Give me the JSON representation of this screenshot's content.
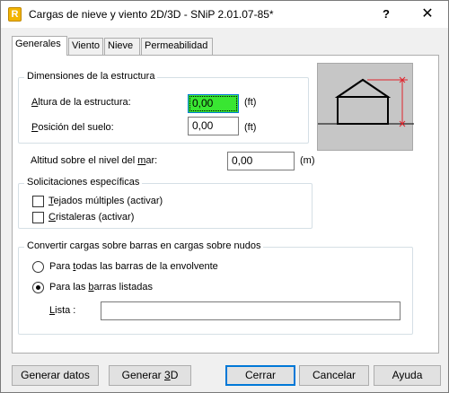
{
  "window": {
    "title": "Cargas de nieve y viento 2D/3D - SNiP 2.01.07-85*",
    "app_icon_letter": "R",
    "help_glyph": "?",
    "close_glyph": "✕"
  },
  "tabs": [
    {
      "label": "Generales",
      "active": true
    },
    {
      "label": "Viento",
      "active": false
    },
    {
      "label": "Nieve",
      "active": false
    },
    {
      "label": "Permeabilidad",
      "active": false
    }
  ],
  "dimensiones": {
    "title": "Dimensiones de la estructura",
    "altura": {
      "label_u": "A",
      "label_rest": "ltura de la estructura:",
      "value": "0,00",
      "unit": "(ft)"
    },
    "posicion": {
      "label_u": "P",
      "label_rest": "osición del suelo:",
      "value": "0,00",
      "unit": "(ft)"
    }
  },
  "altitud": {
    "label_pre": "Altitud sobre el nivel del ",
    "label_u": "m",
    "label_post": "ar:",
    "value": "0,00",
    "unit": "(m)"
  },
  "solicitaciones": {
    "title": "Solicitaciones específicas",
    "tejados": {
      "label_u": "T",
      "label_rest": "ejados múltiples (activar)",
      "checked": false
    },
    "cristaleras": {
      "label_u": "C",
      "label_rest": "ristaleras (activar)",
      "checked": false
    }
  },
  "convertir": {
    "title": "Convertir cargas sobre barras en cargas sobre nudos",
    "todas": {
      "label_pre": "Para ",
      "label_u": "t",
      "label_post": "odas las barras de la envolvente",
      "checked": false
    },
    "listadas": {
      "label_pre": "Para las ",
      "label_u": "b",
      "label_post": "arras listadas",
      "checked": true
    },
    "lista": {
      "label_u": "L",
      "label_rest": "ista :",
      "value": ""
    }
  },
  "buttons": {
    "generar_datos": "Generar datos",
    "generar_3d_pre": "Generar ",
    "generar_3d_u": "3",
    "generar_3d_post": "D",
    "cerrar": "Cerrar",
    "cancelar": "Cancelar",
    "ayuda": "Ayuda"
  },
  "colors": {
    "active_field": "#39e632",
    "dimension_line": "#e0242c",
    "accent": "#0078d7"
  },
  "icons": [
    "building-dimension-preview",
    "help-icon",
    "close-icon"
  ]
}
